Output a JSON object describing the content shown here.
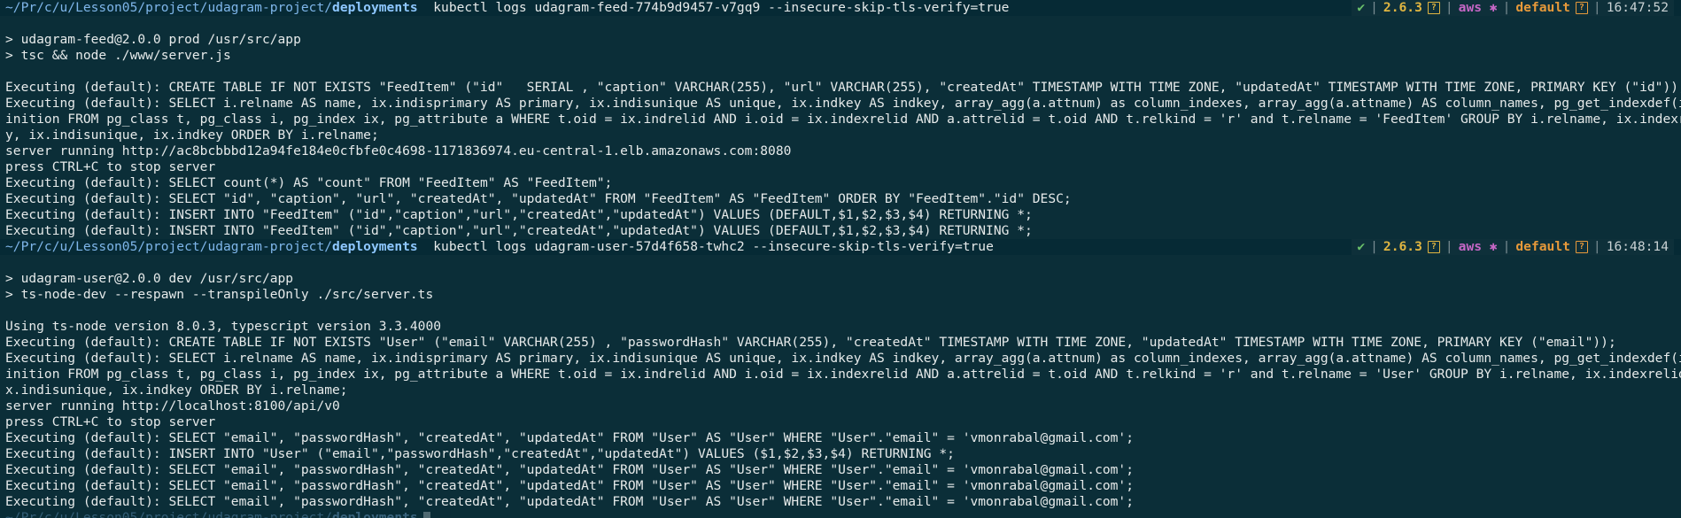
{
  "colors": {
    "background": "#0b2e38",
    "prompt_path": "#7fb6ea",
    "ok": "#6ac06a",
    "version": "#e0b541",
    "aws": "#c667c6",
    "context": "#e6993a"
  },
  "sessions": [
    {
      "prompt": {
        "path_prefix": "~/Pr/c/u/Lesson05/project/udagram-project/",
        "path_last": "deployments",
        "command": "kubectl logs udagram-feed-774b9d9457-v7gq9 --insecure-skip-tls-verify=true",
        "status": {
          "ok": "✔",
          "version": "2.6.3",
          "aws": "aws ✱",
          "context": "default",
          "time": "16:47:52"
        }
      },
      "output": [
        "",
        "> udagram-feed@2.0.0 prod /usr/src/app",
        "> tsc && node ./www/server.js",
        "",
        "Executing (default): CREATE TABLE IF NOT EXISTS \"FeedItem\" (\"id\"   SERIAL , \"caption\" VARCHAR(255), \"url\" VARCHAR(255), \"createdAt\" TIMESTAMP WITH TIME ZONE, \"updatedAt\" TIMESTAMP WITH TIME ZONE, PRIMARY KEY (\"id\"));",
        "Executing (default): SELECT i.relname AS name, ix.indisprimary AS primary, ix.indisunique AS unique, ix.indkey AS indkey, array_agg(a.attnum) as column_indexes, array_agg(a.attname) AS column_names, pg_get_indexdef(ix.indexrelid) AS def",
        "inition FROM pg_class t, pg_class i, pg_index ix, pg_attribute a WHERE t.oid = ix.indrelid AND i.oid = ix.indexrelid AND a.attrelid = t.oid AND t.relkind = 'r' and t.relname = 'FeedItem' GROUP BY i.relname, ix.indexrelid, ix.indisprimar",
        "y, ix.indisunique, ix.indkey ORDER BY i.relname;",
        "server running http://ac8bcbbbd12a94fe184e0cfbfe0c4698-1171836974.eu-central-1.elb.amazonaws.com:8080",
        "press CTRL+C to stop server",
        "Executing (default): SELECT count(*) AS \"count\" FROM \"FeedItem\" AS \"FeedItem\";",
        "Executing (default): SELECT \"id\", \"caption\", \"url\", \"createdAt\", \"updatedAt\" FROM \"FeedItem\" AS \"FeedItem\" ORDER BY \"FeedItem\".\"id\" DESC;",
        "Executing (default): INSERT INTO \"FeedItem\" (\"id\",\"caption\",\"url\",\"createdAt\",\"updatedAt\") VALUES (DEFAULT,$1,$2,$3,$4) RETURNING *;",
        "Executing (default): INSERT INTO \"FeedItem\" (\"id\",\"caption\",\"url\",\"createdAt\",\"updatedAt\") VALUES (DEFAULT,$1,$2,$3,$4) RETURNING *;"
      ]
    },
    {
      "prompt": {
        "path_prefix": "~/Pr/c/u/Lesson05/project/udagram-project/",
        "path_last": "deployments",
        "command": "kubectl logs udagram-user-57d4f658-twhc2 --insecure-skip-tls-verify=true",
        "status": {
          "ok": "✔",
          "version": "2.6.3",
          "aws": "aws ✱",
          "context": "default",
          "time": "16:48:14"
        }
      },
      "output": [
        "",
        "> udagram-user@2.0.0 dev /usr/src/app",
        "> ts-node-dev --respawn --transpileOnly ./src/server.ts",
        "",
        "Using ts-node version 8.0.3, typescript version 3.3.4000",
        "Executing (default): CREATE TABLE IF NOT EXISTS \"User\" (\"email\" VARCHAR(255) , \"passwordHash\" VARCHAR(255), \"createdAt\" TIMESTAMP WITH TIME ZONE, \"updatedAt\" TIMESTAMP WITH TIME ZONE, PRIMARY KEY (\"email\"));",
        "Executing (default): SELECT i.relname AS name, ix.indisprimary AS primary, ix.indisunique AS unique, ix.indkey AS indkey, array_agg(a.attnum) as column_indexes, array_agg(a.attname) AS column_names, pg_get_indexdef(ix.indexrelid) AS def",
        "inition FROM pg_class t, pg_class i, pg_index ix, pg_attribute a WHERE t.oid = ix.indrelid AND i.oid = ix.indexrelid AND a.attrelid = t.oid AND t.relkind = 'r' and t.relname = 'User' GROUP BY i.relname, ix.indexrelid, ix.indisprimary, i",
        "x.indisunique, ix.indkey ORDER BY i.relname;",
        "server running http://localhost:8100/api/v0",
        "press CTRL+C to stop server",
        "Executing (default): SELECT \"email\", \"passwordHash\", \"createdAt\", \"updatedAt\" FROM \"User\" AS \"User\" WHERE \"User\".\"email\" = 'vmonrabal@gmail.com';",
        "Executing (default): INSERT INTO \"User\" (\"email\",\"passwordHash\",\"createdAt\",\"updatedAt\") VALUES ($1,$2,$3,$4) RETURNING *;",
        "Executing (default): SELECT \"email\", \"passwordHash\", \"createdAt\", \"updatedAt\" FROM \"User\" AS \"User\" WHERE \"User\".\"email\" = 'vmonrabal@gmail.com';",
        "Executing (default): SELECT \"email\", \"passwordHash\", \"createdAt\", \"updatedAt\" FROM \"User\" AS \"User\" WHERE \"User\".\"email\" = 'vmonrabal@gmail.com';",
        "Executing (default): SELECT \"email\", \"passwordHash\", \"createdAt\", \"updatedAt\" FROM \"User\" AS \"User\" WHERE \"User\".\"email\" = 'vmonrabal@gmail.com';"
      ]
    }
  ],
  "status_icons": {
    "help": "?"
  }
}
